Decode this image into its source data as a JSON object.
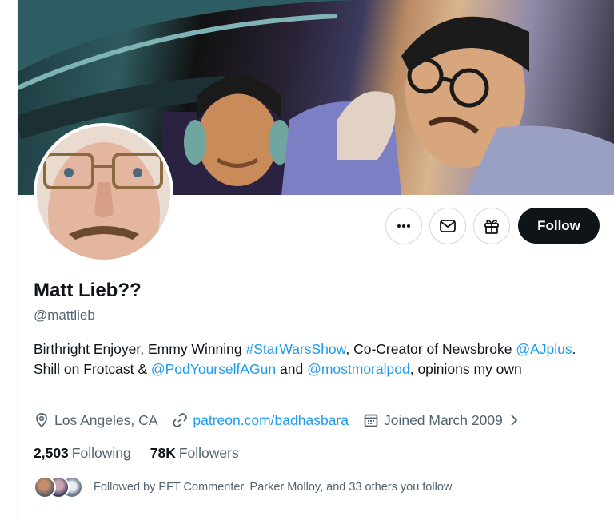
{
  "profile": {
    "display_name": "Matt Lieb??",
    "handle": "@mattlieb",
    "bio": {
      "t1": "Birthright Enjoyer, Emmy Winning ",
      "hashtag": "#StarWarsShow",
      "t2": ", Co-Creator of Newsbroke ",
      "mention1": "@AJplus",
      "t3": ". Shill on Frotcast & ",
      "mention2": "@PodYourselfAGun",
      "t4": " and ",
      "mention3": "@mostmoralpod",
      "t5": ", opinions my own"
    },
    "location": "Los Angeles, CA",
    "website": "patreon.com/badhasbara",
    "joined": "Joined March 2009"
  },
  "actions": {
    "follow_label": "Follow",
    "more_icon": "more-horizontal-icon",
    "message_icon": "envelope-icon",
    "gift_icon": "gift-icon"
  },
  "stats": {
    "following_count": "2,503",
    "following_label": "Following",
    "followers_count": "78K",
    "followers_label": "Followers"
  },
  "followed_by": {
    "text": "Followed by PFT Commenter, Parker Molloy, and 33 others you follow"
  },
  "colors": {
    "accent": "#1d9bf0",
    "text_primary": "#0f1419",
    "text_secondary": "#536471",
    "follow_bg": "#0f1419"
  }
}
